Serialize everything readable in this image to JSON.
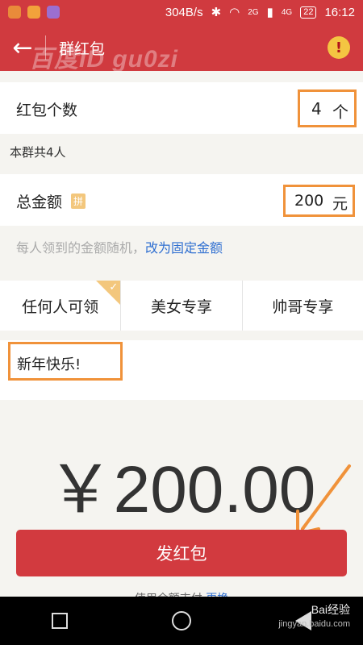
{
  "status_bar": {
    "speed": "304B/s",
    "network1": "2G",
    "network2": "4G",
    "battery": "22",
    "time": "16:12"
  },
  "header": {
    "watermark": "百度ID gu0zi",
    "back_icon": "arrow-left-icon",
    "title": "群红包",
    "info_icon": "!"
  },
  "packet_count": {
    "label": "红包个数",
    "value": "4",
    "unit": "个"
  },
  "group_note": "本群共4人",
  "total_amount": {
    "label": "总金额",
    "badge": "拼",
    "value": "200",
    "unit": "元"
  },
  "hint": {
    "text": "每人领到的金额随机，",
    "link": "改为固定金额"
  },
  "tabs": [
    {
      "label": "任何人可领",
      "selected": true
    },
    {
      "label": "美女专享",
      "selected": false
    },
    {
      "label": "帅哥专享",
      "selected": false
    }
  ],
  "message": "新年快乐!",
  "amount_display": "￥200.00",
  "send_button": "发红包",
  "pay_note": {
    "text": "使用余额支付",
    "link": "更换"
  },
  "baidu_watermark": {
    "title": "Bai经验",
    "url": "jingyan.baidu.com"
  },
  "colors": {
    "brand_red": "#d03a3f",
    "highlight_orange": "#f0923a",
    "link_blue": "#2f6fd1",
    "tab_corner": "#f3c77d"
  }
}
